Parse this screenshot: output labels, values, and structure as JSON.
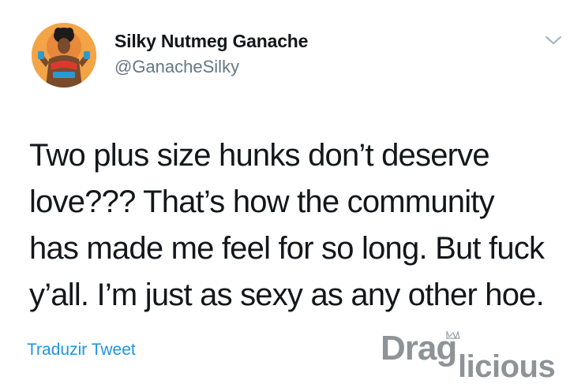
{
  "tweet": {
    "author": {
      "display_name": "Silky Nutmeg Ganache",
      "handle": "@GanacheSilky"
    },
    "text": "Two plus size hunks don’t deserve\nlove???  That’s how the community\nhas made me feel for so long.  But fuck\ny’all. I’m just as sexy as any other hoe.",
    "translate_label": "Traduzir Tweet"
  },
  "watermark": {
    "text": "Draglicious"
  },
  "icons": {
    "menu": "chevron-down-icon",
    "watermark_crown": "crown-icon"
  },
  "colors": {
    "text": "#14171a",
    "secondary": "#657786",
    "link": "#1b95e0",
    "watermark": "#8a8f94"
  }
}
